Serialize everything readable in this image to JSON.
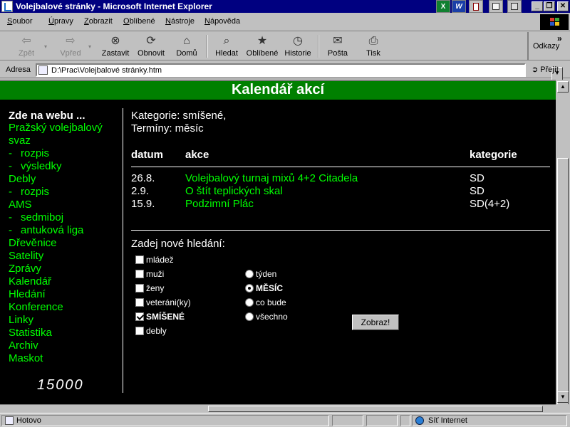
{
  "window": {
    "title": "Volejbalové stránky - Microsoft Internet Explorer",
    "minimize": "_",
    "restore": "❐",
    "close": "✕"
  },
  "taskbar_apps": [
    "X",
    "W"
  ],
  "menu": [
    {
      "accel": "S",
      "rest": "oubor"
    },
    {
      "accel": "Ú",
      "rest": "pravy"
    },
    {
      "accel": "Z",
      "rest": "obrazit"
    },
    {
      "accel": "O",
      "rest": "blíbené"
    },
    {
      "accel": "N",
      "rest": "ástroje"
    },
    {
      "accel": "N",
      "rest": "ápověda"
    }
  ],
  "toolbar": {
    "back": "Zpět",
    "forward": "Vpřed",
    "stop": "Zastavit",
    "refresh": "Obnovit",
    "home": "Domů",
    "search": "Hledat",
    "favorites": "Oblíbené",
    "history": "Historie",
    "mail": "Pošta",
    "print": "Tisk",
    "links": "Odkazy"
  },
  "address": {
    "label": "Adresa",
    "label_accel": "d",
    "url": "D:\\Prac\\Volejbalové stránky.htm",
    "go": "Přejít"
  },
  "page": {
    "banner_title": "Kalendář akcí",
    "sidebar": {
      "heading": "Zde na webu ...",
      "items": [
        {
          "label": "Pražský volejbalový",
          "sub": false
        },
        {
          "label": "svaz",
          "sub": false
        },
        {
          "label": "rozpis",
          "sub": true
        },
        {
          "label": "výsledky",
          "sub": true
        },
        {
          "label": "Debly",
          "sub": false
        },
        {
          "label": "rozpis",
          "sub": true
        },
        {
          "label": "AMS",
          "sub": false
        },
        {
          "label": "sedmiboj",
          "sub": true
        },
        {
          "label": "antuková liga",
          "sub": true
        },
        {
          "label": "Dřevěnice",
          "sub": false
        },
        {
          "label": "Satelity",
          "sub": false
        },
        {
          "label": "Zprávy",
          "sub": false
        },
        {
          "label": "Kalendář",
          "sub": false
        },
        {
          "label": "Hledání",
          "sub": false
        },
        {
          "label": "Konference",
          "sub": false
        },
        {
          "label": "Linky",
          "sub": false
        },
        {
          "label": "Statistika",
          "sub": false
        },
        {
          "label": "Archiv",
          "sub": false
        },
        {
          "label": "Maskot",
          "sub": false
        }
      ],
      "counter": "15000"
    },
    "category_line": "Kategorie: smíšené,",
    "terms_line": "Termíny: měsíc",
    "table": {
      "headers": [
        "datum",
        "akce",
        "kategorie"
      ],
      "rows": [
        {
          "date": "26.8.",
          "event": "Volejbalový turnaj mixů 4+2 Citadela",
          "category": "SD"
        },
        {
          "date": "2.9.",
          "event": "O štít teplických skal",
          "category": "SD"
        },
        {
          "date": "15.9.",
          "event": "Podzimní Plác",
          "category": "SD(4+2)"
        }
      ]
    },
    "search": {
      "prompt": "Zadej nové hledání:",
      "checkboxes": [
        {
          "label": "mládež",
          "checked": false
        },
        {
          "label": "muži",
          "checked": false
        },
        {
          "label": "ženy",
          "checked": false
        },
        {
          "label": "veteráni(ky)",
          "checked": false
        },
        {
          "label": "SMÍŠENÉ",
          "checked": true
        },
        {
          "label": "debly",
          "checked": false
        }
      ],
      "radios": [
        {
          "label": "týden",
          "checked": false
        },
        {
          "label": "MĚSÍC",
          "checked": true
        },
        {
          "label": "co bude",
          "checked": false
        },
        {
          "label": "všechno",
          "checked": false
        }
      ],
      "submit": "Zobraz!"
    }
  },
  "status": {
    "text": "Hotovo",
    "zone": "Síť Internet"
  },
  "colors": {
    "titlebar": "#000080",
    "banner": "#008000",
    "link": "#00ff00",
    "page_bg": "#000000"
  }
}
